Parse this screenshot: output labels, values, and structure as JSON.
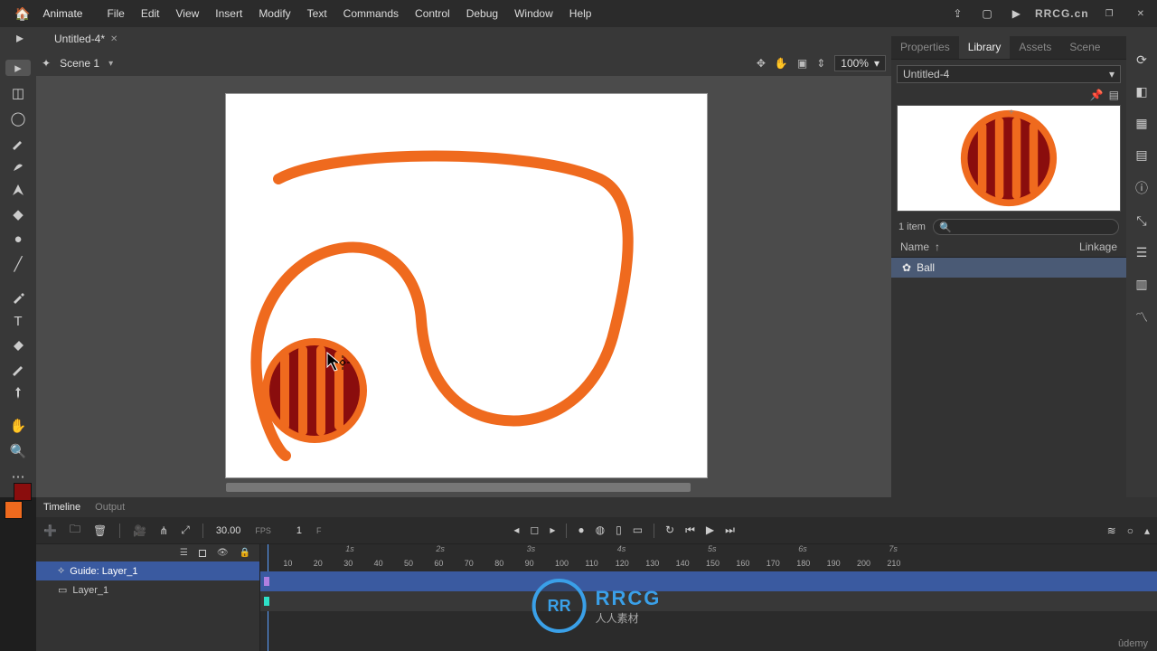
{
  "app": {
    "name": "Animate"
  },
  "menu": [
    "File",
    "Edit",
    "View",
    "Insert",
    "Modify",
    "Text",
    "Commands",
    "Control",
    "Debug",
    "Window",
    "Help"
  ],
  "watermark_tr": "RRCG.cn",
  "doc_tab": "Untitled-4*",
  "scene": {
    "name": "Scene 1",
    "zoom": "100%"
  },
  "panels": {
    "tabs": [
      "Properties",
      "Library",
      "Assets",
      "Scene"
    ],
    "active_tab": "Library",
    "doc_name": "Untitled-4",
    "item_count": "1 item",
    "name_col": "Name",
    "linkage_col": "Linkage",
    "items": [
      {
        "name": "Ball"
      }
    ]
  },
  "timeline": {
    "tabs": [
      "Timeline",
      "Output"
    ],
    "active_tab": "Timeline",
    "fps": "30.00",
    "fps_label": "FPS",
    "frame": "1",
    "frame_label": "F",
    "seconds": [
      "1s",
      "2s",
      "3s",
      "4s",
      "5s",
      "6s",
      "7s"
    ],
    "ticks": [
      10,
      20,
      30,
      40,
      50,
      60,
      70,
      80,
      90,
      100,
      110,
      120,
      130,
      140,
      150,
      160,
      170,
      180,
      190,
      200,
      210
    ],
    "layers": [
      {
        "name": "Guide: Layer_1",
        "selected": true,
        "type": "guide"
      },
      {
        "name": "Layer_1",
        "selected": false,
        "type": "normal"
      }
    ]
  },
  "logo": {
    "abbr": "RR",
    "line1": "RRCG",
    "line2": "人人素材"
  },
  "footer": "ûdemy"
}
